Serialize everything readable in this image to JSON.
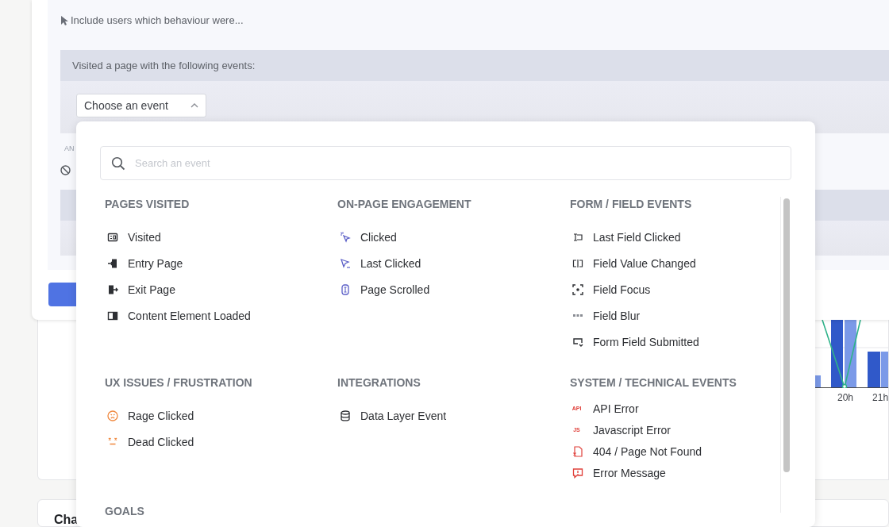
{
  "filter": {
    "intro": "Include users which behaviour were...",
    "block_title": "Visited a page with the following events:",
    "dropdown": {
      "label": "Choose an event",
      "expanded": true
    },
    "connector": "AN"
  },
  "menu": {
    "search": {
      "placeholder": "Search an event"
    },
    "sections": [
      {
        "title": "PAGES VISITED",
        "kind": "standard",
        "items": [
          {
            "kind": "visited",
            "label": "Visited"
          },
          {
            "kind": "entry",
            "label": "Entry Page"
          },
          {
            "kind": "exit",
            "label": "Exit Page"
          },
          {
            "kind": "content",
            "label": "Content Element Loaded"
          }
        ]
      },
      {
        "title": "ON-PAGE ENGAGEMENT",
        "kind": "standard",
        "items": [
          {
            "kind": "clicked",
            "label": "Clicked"
          },
          {
            "kind": "lastclick",
            "label": "Last Clicked"
          },
          {
            "kind": "scrolled",
            "label": "Page Scrolled"
          }
        ]
      },
      {
        "title": "FORM / FIELD EVENTS",
        "kind": "standard",
        "items": [
          {
            "kind": "lastfield",
            "label": "Last Field Clicked"
          },
          {
            "kind": "changed",
            "label": "Field Value Changed"
          },
          {
            "kind": "focus",
            "label": "Field Focus"
          },
          {
            "kind": "blur",
            "label": "Field Blur"
          },
          {
            "kind": "submitted",
            "label": "Form Field Submitted"
          }
        ]
      },
      {
        "title": "UX ISSUES / FRUSTRATION",
        "kind": "standard",
        "items": [
          {
            "kind": "rage",
            "label": "Rage Clicked"
          },
          {
            "kind": "dead",
            "label": "Dead Clicked"
          }
        ]
      },
      {
        "title": "INTEGRATIONS",
        "kind": "standard",
        "items": [
          {
            "kind": "datalayer",
            "label": "Data Layer Event"
          }
        ]
      },
      {
        "title": "SYSTEM / TECHNICAL EVENTS",
        "kind": "compact",
        "items": [
          {
            "kind": "badge",
            "badge": "API",
            "label": "API Error"
          },
          {
            "kind": "badge",
            "badge": "JS",
            "label": "Javascript Error"
          },
          {
            "kind": "notfound",
            "label": "404 / Page Not Found"
          },
          {
            "kind": "message",
            "label": "Error Message"
          }
        ]
      },
      {
        "title": "GOALS",
        "kind": "standard"
      }
    ]
  },
  "chart": {
    "labels": [
      "20h",
      "21h"
    ]
  },
  "card_title": "Cha"
}
